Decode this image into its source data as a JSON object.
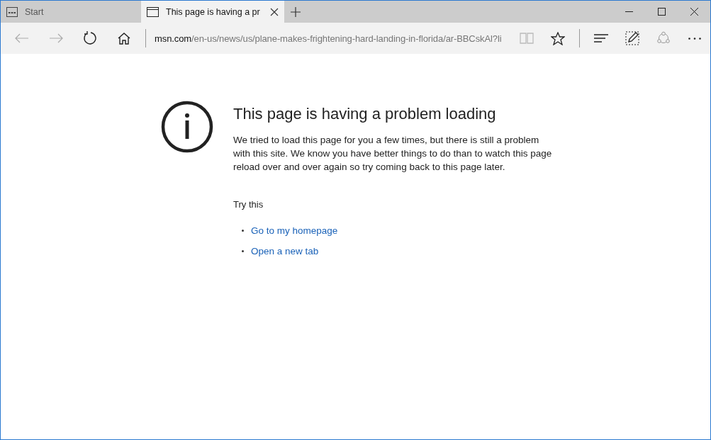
{
  "tabs": [
    {
      "label": "Start",
      "kind": "start",
      "selected": false
    },
    {
      "label": "This page is having a pr",
      "kind": "page",
      "selected": true
    }
  ],
  "address": {
    "domain": "msn.com",
    "path": "/en-us/news/us/plane-makes-frightening-hard-landing-in-florida/ar-BBCskAl?li"
  },
  "error": {
    "title": "This page is having a problem loading",
    "message": "We tried to load this page for you a few times, but there is still a problem with this site. We know you have better things to do than to watch this page reload over and over again so try coming back to this page later.",
    "try_heading": "Try this",
    "links": [
      "Go to my homepage",
      "Open a new tab"
    ]
  }
}
